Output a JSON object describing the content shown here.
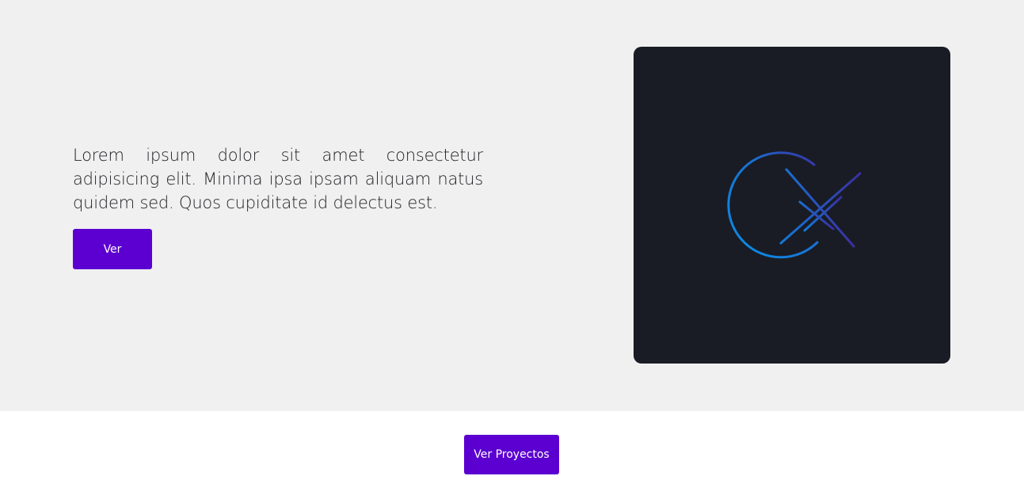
{
  "hero": {
    "description": "Lorem ipsum dolor sit amet consectetur adipisicing elit. Minima ipsa ipsam aliquam natus quidem sed. Quos cupiditate id delectus est.",
    "button_label": "Ver",
    "logo": {
      "icon": "cx-logo-icon",
      "colors": {
        "card_background": "#191c24",
        "gradient_start": "#0a8fe8",
        "gradient_end": "#3a2fa0"
      }
    }
  },
  "footer": {
    "button_label": "Ver Proyectos"
  },
  "colors": {
    "hero_background": "#f0f0f0",
    "page_background": "#ffffff",
    "accent": "#5b00d1",
    "text": "#1f1f24"
  }
}
